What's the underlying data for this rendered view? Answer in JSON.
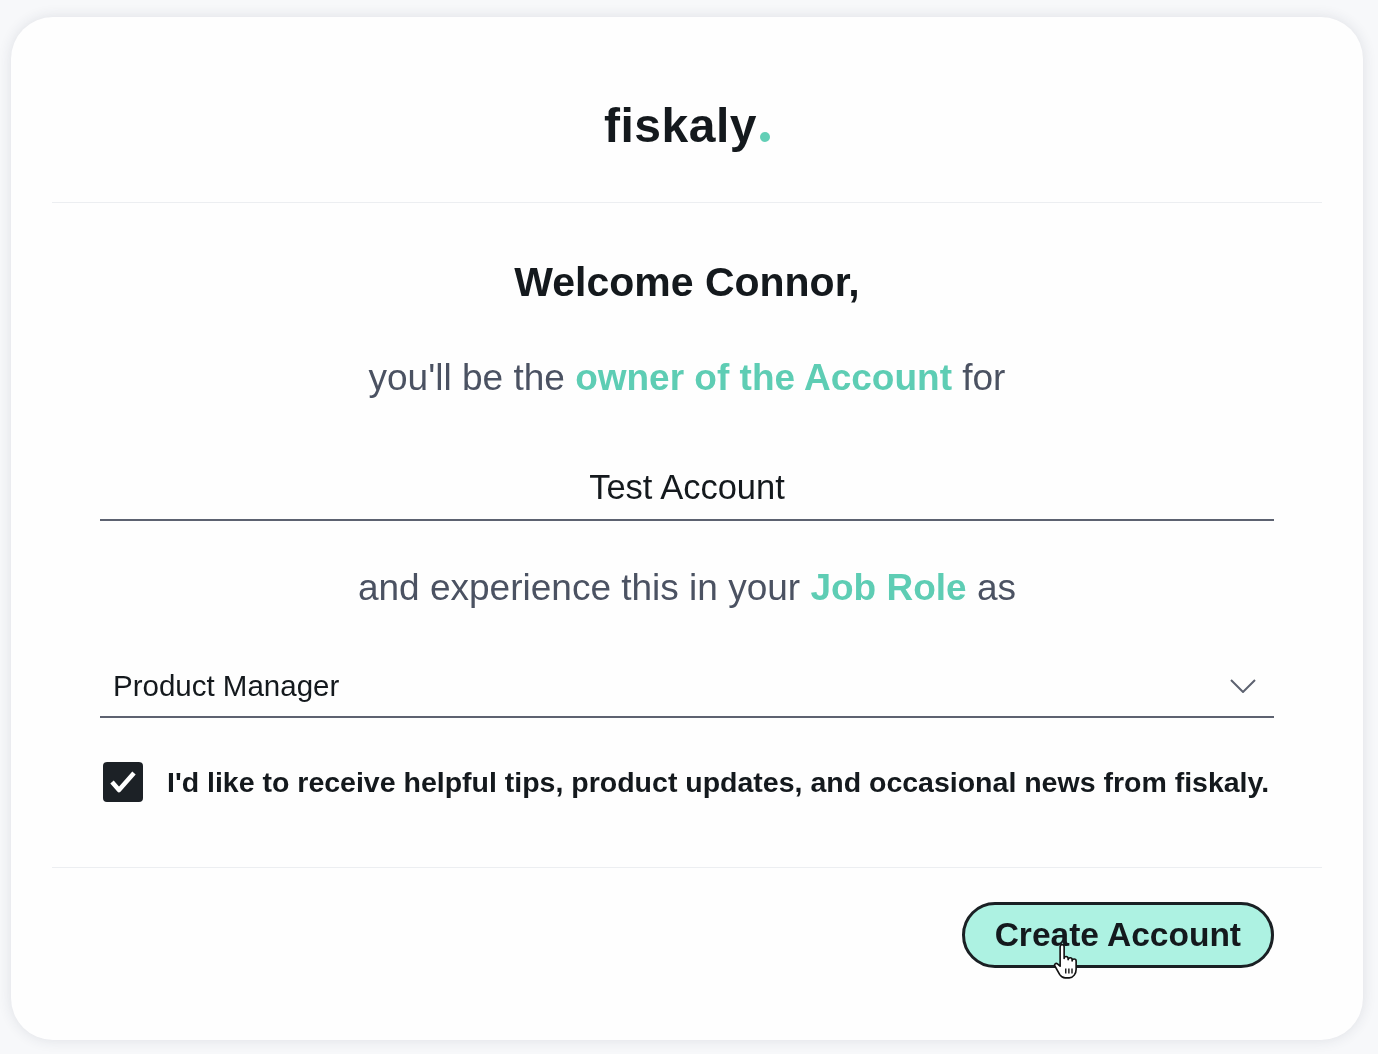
{
  "logo": {
    "text": "fiskaly"
  },
  "heading": "Welcome Connor,",
  "owner_line": "you'll be the **owner of the Account** for",
  "account_field": {
    "value": "Test Account"
  },
  "role_line": "and experience this in your **Job Role** as",
  "role_select": {
    "value": "Product Manager"
  },
  "newsletter_checkbox": {
    "label": "I'd like to receive helpful tips, product updates, and occasional news from fiskaly.",
    "checked": true
  },
  "create_button": {
    "label": "Create Account"
  }
}
